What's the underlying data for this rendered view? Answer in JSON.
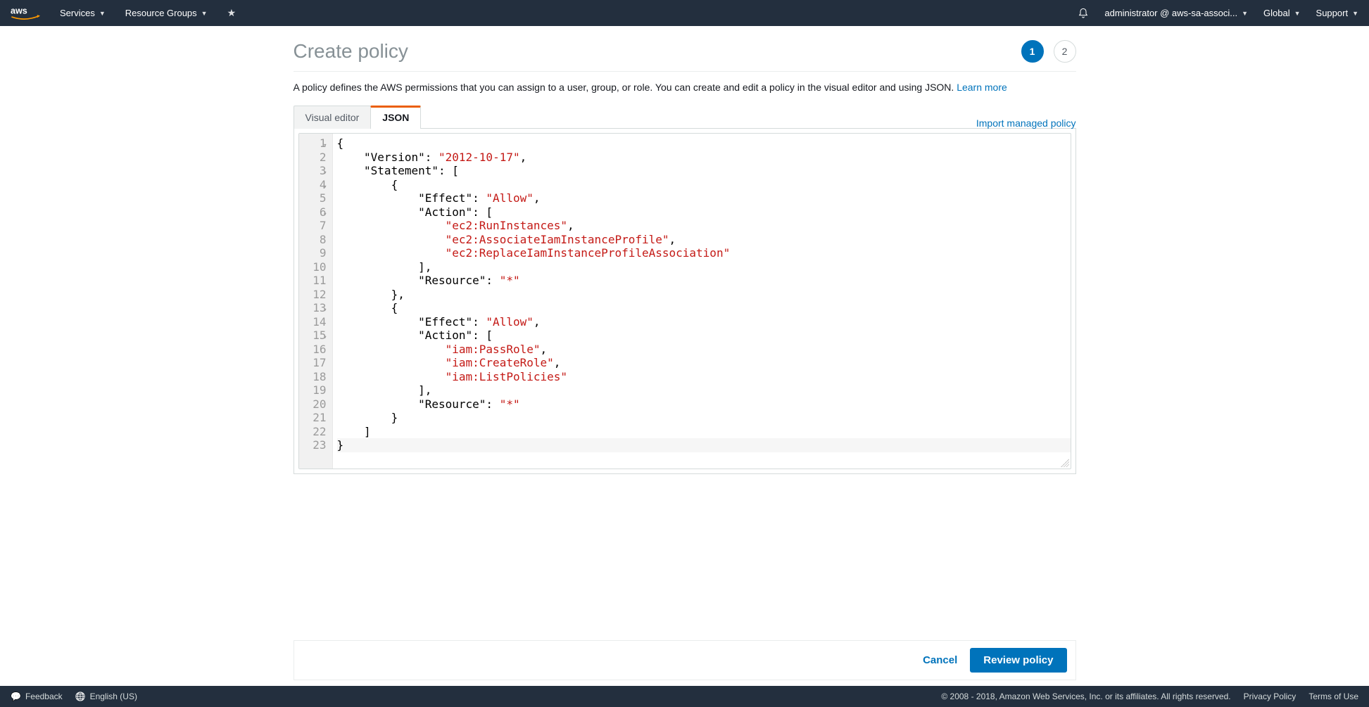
{
  "topnav": {
    "services": "Services",
    "resource_groups": "Resource Groups",
    "account": "administrator @ aws-sa-associ...",
    "region": "Global",
    "support": "Support"
  },
  "page": {
    "title": "Create policy",
    "steps": [
      "1",
      "2"
    ],
    "active_step": 0,
    "description_pre": "A policy defines the AWS permissions that you can assign to a user, group, or role. You can create and edit a policy in the visual editor and using JSON. ",
    "learn_more": "Learn more"
  },
  "tabs": {
    "visual_editor": "Visual editor",
    "json": "JSON",
    "active": "json",
    "import_link": "Import managed policy"
  },
  "editor": {
    "line_numbers": [
      "1",
      "2",
      "3",
      "4",
      "5",
      "6",
      "7",
      "8",
      "9",
      "10",
      "11",
      "12",
      "13",
      "14",
      "15",
      "16",
      "17",
      "18",
      "19",
      "20",
      "21",
      "22",
      "23"
    ],
    "fold_lines": [
      1,
      3,
      4,
      6,
      13,
      15
    ],
    "current_line": 23,
    "policy": {
      "Version": "2012-10-17",
      "Statement": [
        {
          "Effect": "Allow",
          "Action": [
            "ec2:RunInstances",
            "ec2:AssociateIamInstanceProfile",
            "ec2:ReplaceIamInstanceProfileAssociation"
          ],
          "Resource": "*"
        },
        {
          "Effect": "Allow",
          "Action": [
            "iam:PassRole",
            "iam:CreateRole",
            "iam:ListPolicies"
          ],
          "Resource": "*"
        }
      ]
    }
  },
  "actions": {
    "cancel": "Cancel",
    "review": "Review policy"
  },
  "footer": {
    "feedback": "Feedback",
    "language": "English (US)",
    "copyright": "© 2008 - 2018, Amazon Web Services, Inc. or its affiliates. All rights reserved.",
    "privacy": "Privacy Policy",
    "terms": "Terms of Use"
  }
}
